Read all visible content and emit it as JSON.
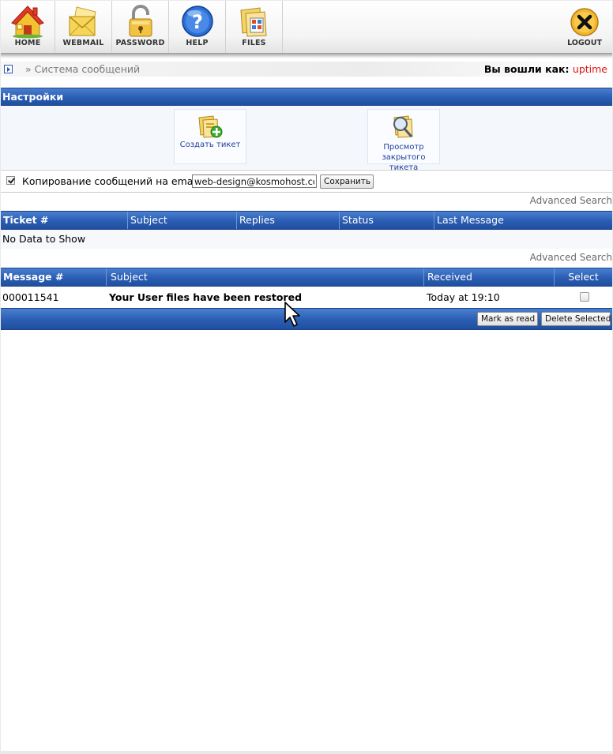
{
  "toolbar": {
    "items": [
      {
        "label": "HOME",
        "icon": "house-icon"
      },
      {
        "label": "WEBMAIL",
        "icon": "envelope-icon"
      },
      {
        "label": "PASSWORD",
        "icon": "padlock-icon"
      },
      {
        "label": "HELP",
        "icon": "help-icon"
      },
      {
        "label": "FILES",
        "icon": "files-icon"
      }
    ],
    "logout_label": "LOGOUT"
  },
  "breadcrumb": {
    "text": "» Система сообщений",
    "login_prefix": "Вы вошли как:",
    "username": "uptime"
  },
  "settings": {
    "title": "Настройки",
    "create_ticket": "Создать тикет",
    "view_closed": "Просмотр закрытого тикета",
    "copy_label": "Копирование сообщений на email",
    "copy_checked": true,
    "email_value": "web-design@kosmohost.com",
    "save_label": "Сохранить"
  },
  "tickets": {
    "advanced_search": "Advanced Search",
    "columns": [
      "Ticket #",
      "Subject",
      "Replies",
      "Status",
      "Last Message"
    ],
    "empty_text": "No Data to Show"
  },
  "messages": {
    "advanced_search": "Advanced Search",
    "columns": [
      "Message #",
      "Subject",
      "Received",
      "Select"
    ],
    "rows": [
      {
        "number": "000011541",
        "subject": "Your User files have been restored",
        "received": "Today at 19:10",
        "selected": false
      }
    ],
    "mark_read_label": "Mark as read",
    "delete_label": "Delete Selected"
  },
  "colors": {
    "header_blue": "#2a5db3",
    "username_red": "#e01414",
    "link_blue": "#1d3f9a"
  }
}
